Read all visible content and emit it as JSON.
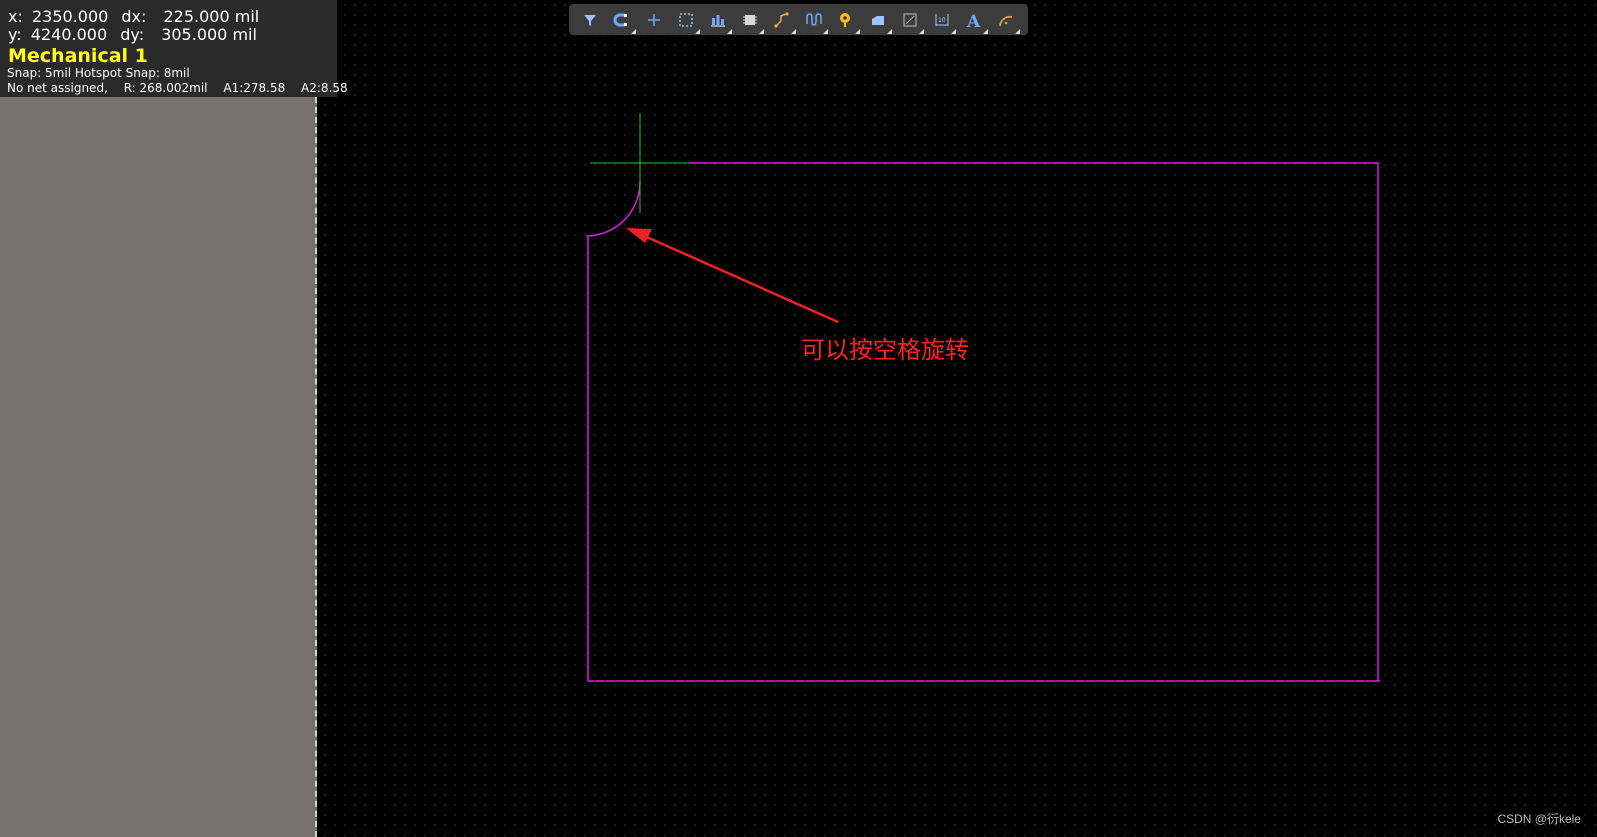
{
  "hud": {
    "x_label": "x:",
    "x_value": "2350.000",
    "dx_label": "dx:",
    "dx_value": "225.000 mil",
    "y_label": "y:",
    "y_value": "4240.000",
    "dy_label": "dy:",
    "dy_value": "305.000 mil",
    "layer": "Mechanical 1",
    "snap": "Snap: 5mil Hotspot Snap: 8mil",
    "net": "No net assigned,",
    "radius": "R: 268.002mil",
    "a1": "A1:278.58",
    "a2": "A2:8.58"
  },
  "toolbar": {
    "items": [
      {
        "icon": "filter-icon"
      },
      {
        "icon": "snap-magnet-icon"
      },
      {
        "icon": "add-cross-icon"
      },
      {
        "icon": "select-rect-icon"
      },
      {
        "icon": "align-icon"
      },
      {
        "icon": "component-icon"
      },
      {
        "icon": "route-track-icon"
      },
      {
        "icon": "interactive-length-icon"
      },
      {
        "icon": "via-pad-icon"
      },
      {
        "icon": "polygon-fill-icon"
      },
      {
        "icon": "region-icon"
      },
      {
        "icon": "dimension-icon"
      },
      {
        "icon": "text-icon"
      },
      {
        "icon": "arc-icon"
      }
    ]
  },
  "annotation": "可以按空格旋转",
  "watermark": "CSDN @衍kele",
  "colors": {
    "board_outline": "#e21be2",
    "crosshair": "#1fd21f",
    "arrow": "#ee2222",
    "layer_text": "#ffff1e"
  }
}
